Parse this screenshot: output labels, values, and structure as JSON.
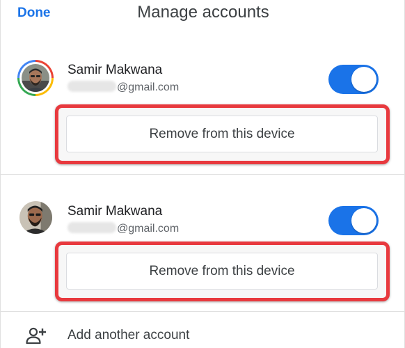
{
  "header": {
    "done_label": "Done",
    "title": "Manage accounts"
  },
  "accounts": [
    {
      "name": "Samir Makwana",
      "email_suffix": "@gmail.com",
      "sync_enabled": true,
      "avatar_ring": true,
      "remove_label": "Remove from this device"
    },
    {
      "name": "Samir Makwana",
      "email_suffix": "@gmail.com",
      "sync_enabled": true,
      "avatar_ring": false,
      "remove_label": "Remove from this device"
    }
  ],
  "add_account": {
    "icon": "add-person-icon",
    "label": "Add another account"
  },
  "colors": {
    "accent": "#1a73e8",
    "highlight": "#e8393e",
    "ring": [
      "#ea4335",
      "#fbbc05",
      "#34a853",
      "#4285f4"
    ]
  }
}
